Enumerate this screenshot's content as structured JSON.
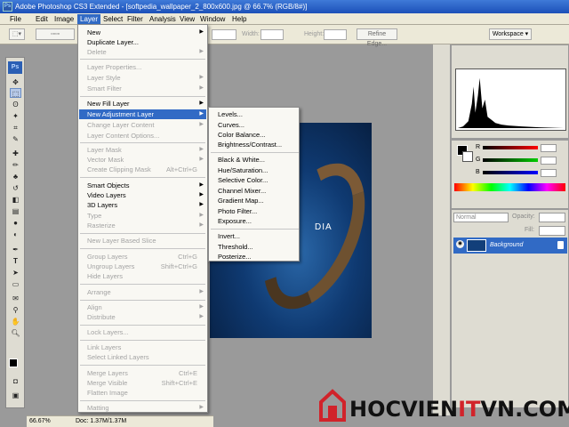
{
  "window": {
    "title": "Adobe Photoshop CS3 Extended - [softpedia_wallpaper_2_800x600.jpg @ 66.7% (RGB/8#)]"
  },
  "menubar": [
    "File",
    "Edit",
    "Image",
    "Layer",
    "Select",
    "Filter",
    "Analysis",
    "View",
    "Window",
    "Help"
  ],
  "options": {
    "width_label": "Width:",
    "height_label": "Height:",
    "refine_edge": "Refine Edge...",
    "workspace": "Workspace ▾"
  },
  "layer_menu": [
    {
      "label": "New",
      "disabled": false,
      "arrow": true
    },
    {
      "label": "Duplicate Layer...",
      "disabled": false
    },
    {
      "label": "Delete",
      "disabled": true,
      "arrow": true
    },
    {
      "label": "Layer Properties...",
      "disabled": true
    },
    {
      "label": "Layer Style",
      "disabled": true,
      "arrow": true
    },
    {
      "label": "Smart Filter",
      "disabled": true,
      "arrow": true
    },
    {
      "label": "New Fill Layer",
      "disabled": false,
      "arrow": true
    },
    {
      "label": "New Adjustment Layer",
      "disabled": false,
      "arrow": true,
      "highlighted": true
    },
    {
      "label": "Change Layer Content",
      "disabled": true,
      "arrow": true
    },
    {
      "label": "Layer Content Options...",
      "disabled": true
    },
    {
      "label": "Layer Mask",
      "disabled": true,
      "arrow": true
    },
    {
      "label": "Vector Mask",
      "disabled": true,
      "arrow": true
    },
    {
      "label": "Create Clipping Mask",
      "disabled": true,
      "shortcut": "Alt+Ctrl+G"
    },
    {
      "label": "Smart Objects",
      "disabled": false,
      "arrow": true
    },
    {
      "label": "Video Layers",
      "disabled": false,
      "arrow": true
    },
    {
      "label": "3D Layers",
      "disabled": false,
      "arrow": true
    },
    {
      "label": "Type",
      "disabled": true,
      "arrow": true
    },
    {
      "label": "Rasterize",
      "disabled": true,
      "arrow": true
    },
    {
      "label": "New Layer Based Slice",
      "disabled": true
    },
    {
      "label": "Group Layers",
      "disabled": true,
      "shortcut": "Ctrl+G"
    },
    {
      "label": "Ungroup Layers",
      "disabled": true,
      "shortcut": "Shift+Ctrl+G"
    },
    {
      "label": "Hide Layers",
      "disabled": true
    },
    {
      "label": "Arrange",
      "disabled": true,
      "arrow": true
    },
    {
      "label": "Align",
      "disabled": true,
      "arrow": true
    },
    {
      "label": "Distribute",
      "disabled": true,
      "arrow": true
    },
    {
      "label": "Lock Layers...",
      "disabled": true
    },
    {
      "label": "Link Layers",
      "disabled": true
    },
    {
      "label": "Select Linked Layers",
      "disabled": true
    },
    {
      "label": "Merge Layers",
      "disabled": true,
      "shortcut": "Ctrl+E"
    },
    {
      "label": "Merge Visible",
      "disabled": true,
      "shortcut": "Shift+Ctrl+E"
    },
    {
      "label": "Flatten Image",
      "disabled": true
    },
    {
      "label": "Matting",
      "disabled": true,
      "arrow": true
    }
  ],
  "adjustment_submenu": [
    "Levels...",
    "Curves...",
    "Color Balance...",
    "Brightness/Contrast...",
    "Black & White...",
    "Hue/Saturation...",
    "Selective Color...",
    "Channel Mixer...",
    "Gradient Map...",
    "Photo Filter...",
    "Exposure...",
    "Invert...",
    "Threshold...",
    "Posterize..."
  ],
  "color_panel": {
    "r_label": "R",
    "g_label": "G",
    "b_label": "B"
  },
  "layers_panel": {
    "blend_mode": "Normal",
    "opacity_label": "Opacity:",
    "fill_label": "Fill:",
    "layer_name": "Background"
  },
  "canvas": {
    "watermark_text": "DIA"
  },
  "status": {
    "zoom": "66.67%",
    "doc": "Doc: 1.37M/1.37M"
  },
  "logo": {
    "part1": "HOCVIEN",
    "part2": "IT",
    "part3": "VN.COM"
  }
}
